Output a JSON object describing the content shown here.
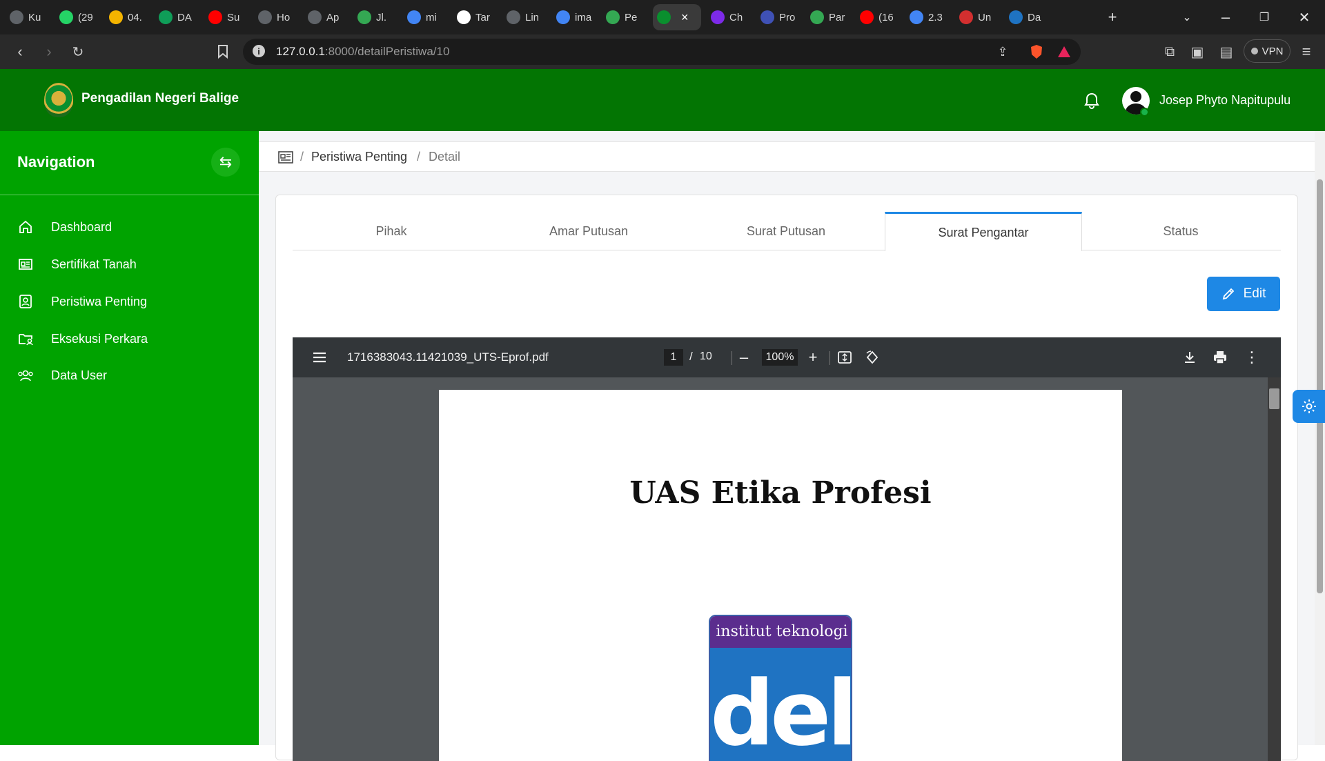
{
  "browser": {
    "tabs": [
      {
        "label": "Ku",
        "icon": "globe-icon",
        "color": "#5f6368"
      },
      {
        "label": "(29",
        "icon": "whatsapp-icon",
        "color": "#25d366"
      },
      {
        "label": "04.",
        "icon": "google-drive-icon",
        "color": "#f4b400"
      },
      {
        "label": "DA",
        "icon": "sheets-plus-icon",
        "color": "#0f9d58"
      },
      {
        "label": "Su",
        "icon": "youtube-icon",
        "color": "#ff0000"
      },
      {
        "label": "Ho",
        "icon": "globe-icon",
        "color": "#5f6368"
      },
      {
        "label": "Ap",
        "icon": "globe-icon",
        "color": "#5f6368"
      },
      {
        "label": "Jl.",
        "icon": "maps-pin-icon",
        "color": "#34a853"
      },
      {
        "label": "mi",
        "icon": "google-icon",
        "color": "#4285f4"
      },
      {
        "label": "Tar",
        "icon": "chatgpt-icon",
        "color": "#ffffff"
      },
      {
        "label": "Lin",
        "icon": "globe-icon",
        "color": "#5f6368"
      },
      {
        "label": "ima",
        "icon": "google-icon",
        "color": "#4285f4"
      },
      {
        "label": "Pe",
        "icon": "maps-pin-icon",
        "color": "#34a853"
      },
      {
        "label": "",
        "icon": "court-logo-icon",
        "color": "#0a8f2e",
        "active": true
      },
      {
        "label": "Ch",
        "icon": "canva-icon",
        "color": "#7d2ae8"
      },
      {
        "label": "Pro",
        "icon": "progress-icon",
        "color": "#3f51b5"
      },
      {
        "label": "Par",
        "icon": "maps-pin-icon",
        "color": "#34a853"
      },
      {
        "label": "(16",
        "icon": "youtube-icon",
        "color": "#ff0000"
      },
      {
        "label": "2.3",
        "icon": "google-icon",
        "color": "#4285f4"
      },
      {
        "label": "Un",
        "icon": "heart-icon",
        "color": "#d32f2f"
      },
      {
        "label": "Da",
        "icon": "del-icon",
        "color": "#1f73c2"
      }
    ],
    "url_host": "127.0.0.1",
    "url_path": ":8000/detailPeristiwa/10",
    "vpn_label": "VPN"
  },
  "app": {
    "title": "Pengadilan Negeri Balige",
    "username": "Josep Phyto Napitupulu",
    "brand_color": "#037503",
    "sidebar_color": "#00a300"
  },
  "sidebar": {
    "title": "Navigation",
    "items": [
      {
        "label": "Dashboard",
        "icon": "home-icon"
      },
      {
        "label": "Sertifikat Tanah",
        "icon": "newspaper-icon"
      },
      {
        "label": "Peristiwa Penting",
        "icon": "person-card-icon"
      },
      {
        "label": "Eksekusi Perkara",
        "icon": "folder-user-icon"
      },
      {
        "label": "Data User",
        "icon": "users-icon"
      }
    ]
  },
  "breadcrumb": {
    "parent": "Peristiwa Penting",
    "current": "Detail"
  },
  "tabs": [
    {
      "label": "Pihak"
    },
    {
      "label": "Amar Putusan"
    },
    {
      "label": "Surat Putusan"
    },
    {
      "label": "Surat Pengantar",
      "active": true
    },
    {
      "label": "Status"
    }
  ],
  "edit_label": "Edit",
  "pdf": {
    "filename": "1716383043.11421039_UTS-Eprof.pdf",
    "page": "1",
    "total_pages": "10",
    "zoom": "100%",
    "doc_title": "UAS Etika Profesi",
    "logo_text_top": "institut teknologi",
    "logo_text_main": "del"
  }
}
